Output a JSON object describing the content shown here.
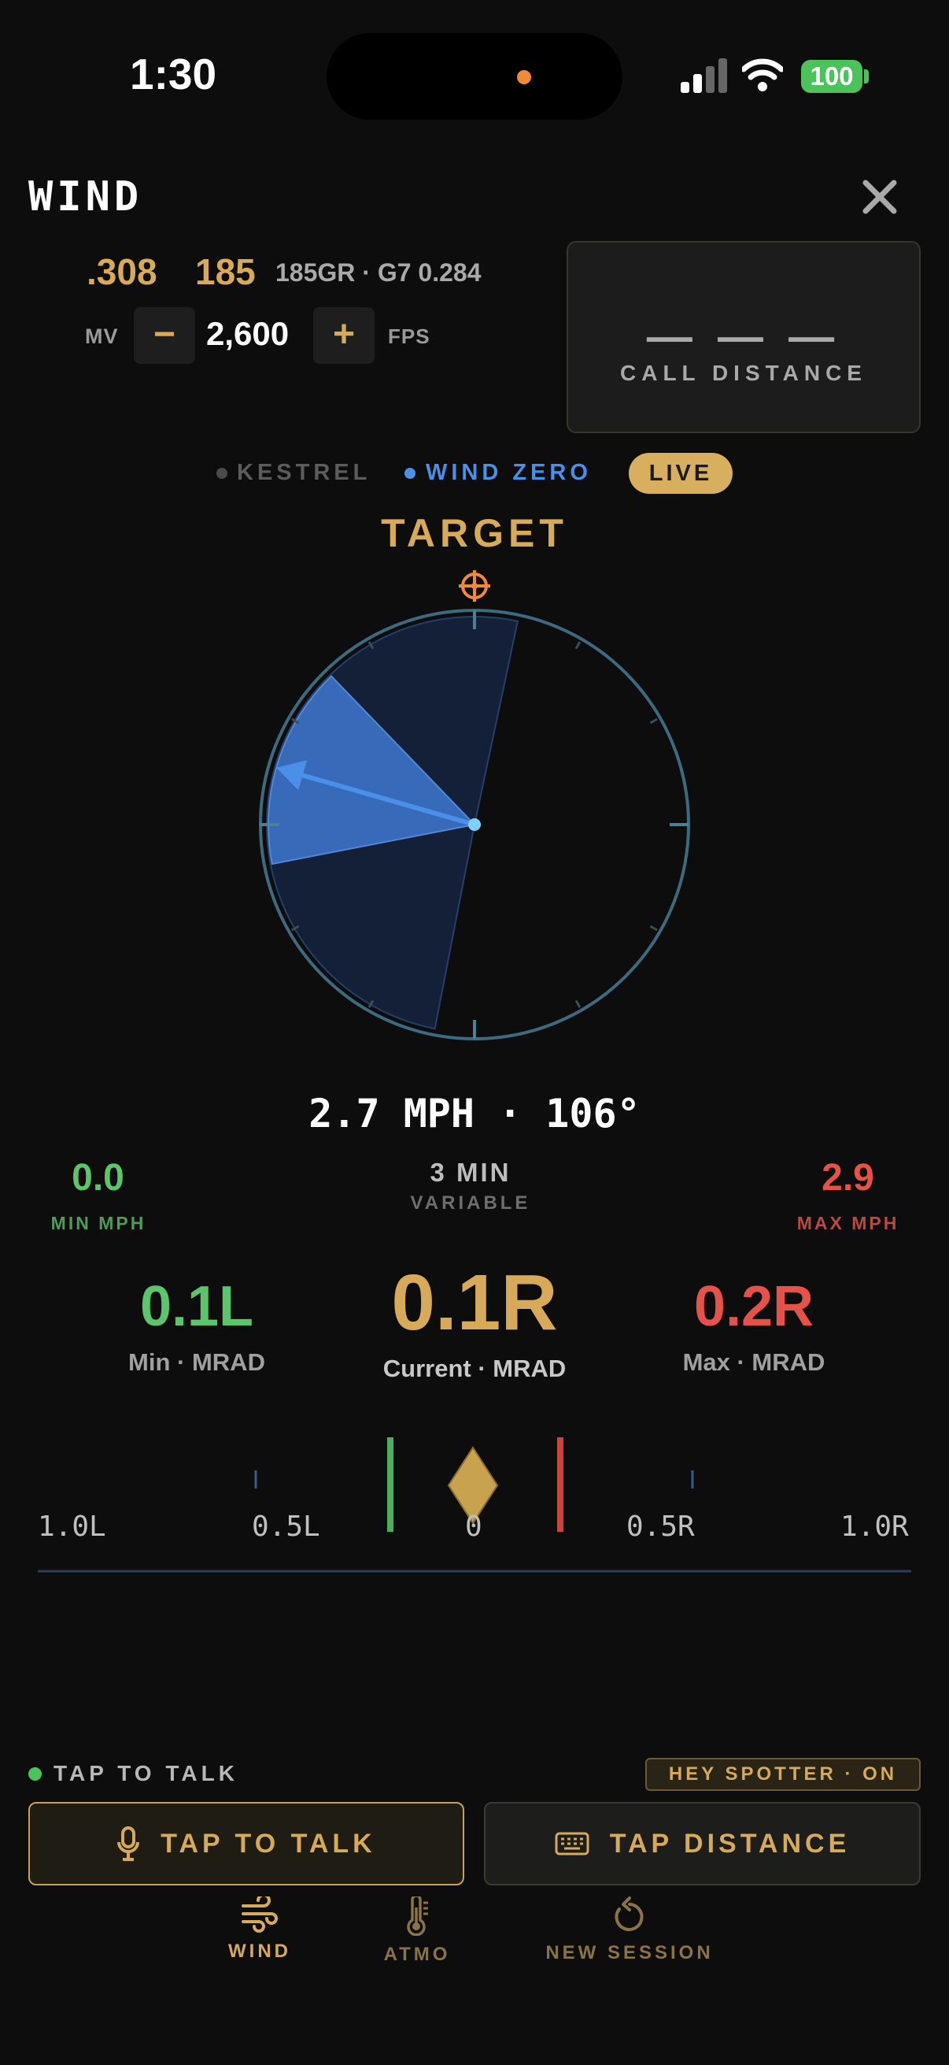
{
  "status_bar": {
    "time": "1:30",
    "battery": "100"
  },
  "header": {
    "title": "WIND"
  },
  "cartridge": {
    "caliber": ".308",
    "grain": "185",
    "bullet": "185GR · G7 0.284"
  },
  "muzzle_velocity": {
    "label": "MV",
    "minus": "−",
    "value": "2,600",
    "plus": "+",
    "unit": "FPS"
  },
  "call_distance": {
    "value": "— — —",
    "label": "CALL DISTANCE"
  },
  "modes": {
    "kestrel": "KESTREL",
    "wind_zero": "WIND ZERO",
    "live": "LIVE"
  },
  "compass": {
    "label": "TARGET",
    "direction_deg": 106,
    "spread_from_deg": 100,
    "spread_to_deg": 133
  },
  "wind": {
    "speed_direction": "2.7 MPH · 106°",
    "min_mph": "0.0",
    "min_mph_label": "MIN MPH",
    "window": "3 MIN",
    "window_label": "VARIABLE",
    "max_mph": "2.9",
    "max_mph_label": "MAX MPH"
  },
  "holds": {
    "min": "0.1L",
    "min_label": "Min · MRAD",
    "current": "0.1R",
    "current_label": "Current · MRAD",
    "max": "0.2R",
    "max_label": "Max · MRAD"
  },
  "scale": {
    "ticks": [
      "1.0L",
      "0.5L",
      "0",
      "0.5R",
      "1.0R"
    ],
    "range_mrad": [
      -1.0,
      1.0
    ],
    "min_marker_mrad": -0.1,
    "current_marker_mrad": 0.1,
    "max_marker_mrad": 0.2
  },
  "voice": {
    "status": "TAP TO TALK",
    "hey_spotter": "HEY SPOTTER · ON"
  },
  "actions": {
    "tap_talk": "TAP TO TALK",
    "tap_distance": "TAP DISTANCE"
  },
  "nav": {
    "wind": "WIND",
    "atmo": "ATMO",
    "new_session": "NEW SESSION"
  },
  "colors": {
    "gold": "#d7aa5a",
    "green": "#5cc46a",
    "red": "#e4524a",
    "blue": "#4a8fe8",
    "background": "#0d0d0d"
  }
}
